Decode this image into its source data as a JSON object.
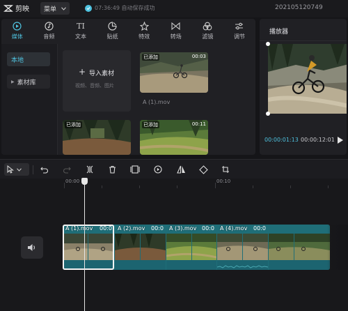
{
  "app": {
    "name": "剪映",
    "menu_label": "菜单",
    "save_status": "07:36:49 自动保存成功",
    "project_title": "202105120749"
  },
  "tabs": [
    {
      "label": "媒体",
      "icon": "media-icon",
      "active": true
    },
    {
      "label": "音频",
      "icon": "audio-icon"
    },
    {
      "label": "文本",
      "icon": "text-icon"
    },
    {
      "label": "贴纸",
      "icon": "sticker-icon"
    },
    {
      "label": "特效",
      "icon": "effects-icon"
    },
    {
      "label": "转场",
      "icon": "transition-icon"
    },
    {
      "label": "滤镜",
      "icon": "filter-icon"
    },
    {
      "label": "调节",
      "icon": "adjust-icon"
    }
  ],
  "sidebar": {
    "local": "本地",
    "library": "素材库"
  },
  "media": {
    "import_label": "导入素材",
    "import_hint": "视频、音频、图片",
    "items": [
      {
        "badge": "已添加",
        "duration": "00:03",
        "filename": "A (1).mov"
      },
      {
        "badge": "已添加",
        "duration": ""
      },
      {
        "badge": "已添加",
        "duration": "00:11"
      }
    ]
  },
  "player": {
    "title": "播放器",
    "current_time": "00:00:01:13",
    "total_time": "00:00:12:01"
  },
  "timeline": {
    "ruler_labels": [
      "00:00",
      "00:10"
    ],
    "clips": [
      {
        "label": "A (1).mov",
        "duration": "00:0"
      },
      {
        "label": "A (2).mov",
        "duration": "00:0"
      },
      {
        "label": "A (3).mov",
        "duration": "00:0"
      },
      {
        "label": "A (4).mov",
        "duration": "00:0"
      },
      {
        "label": "",
        "duration": ""
      }
    ]
  },
  "colors": {
    "accent": "#4fc3e0",
    "track": "#1f6e78"
  }
}
